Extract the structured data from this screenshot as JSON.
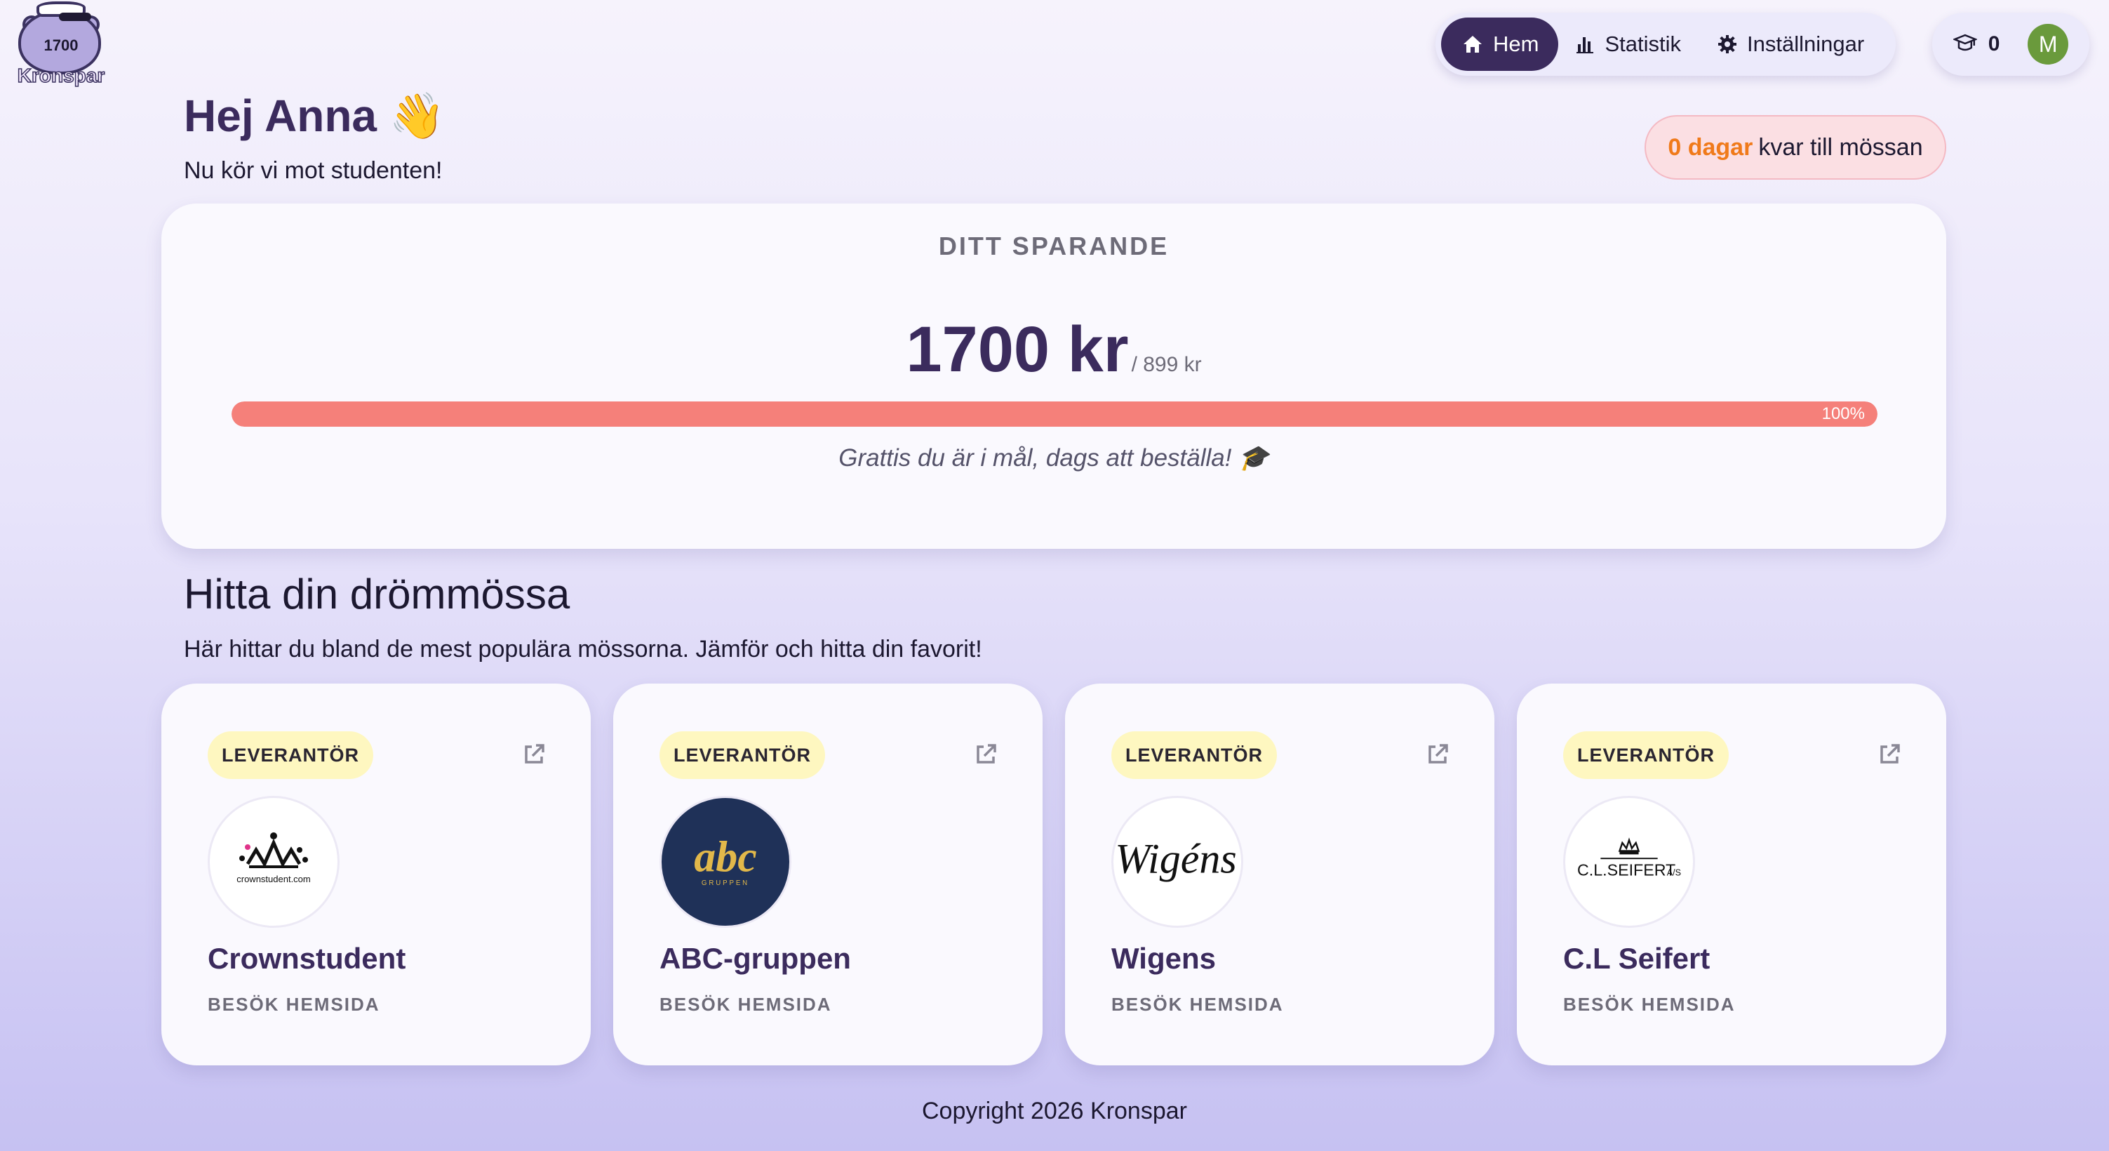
{
  "logo": {
    "amount": "1700",
    "brand": "Kronspar"
  },
  "nav": {
    "items": [
      {
        "label": "Hem",
        "icon": "home-icon",
        "active": true
      },
      {
        "label": "Statistik",
        "icon": "bar-chart-icon",
        "active": false
      },
      {
        "label": "Inställningar",
        "icon": "gear-icon",
        "active": false
      }
    ]
  },
  "user": {
    "cap_count": "0",
    "avatar_initial": "M",
    "avatar_color": "#6a9a3c"
  },
  "greeting": {
    "title": "Hej Anna 👋",
    "subtitle": "Nu kör vi mot studenten!"
  },
  "countdown": {
    "days": "0 dagar",
    "text": "kvar till mössan"
  },
  "savings": {
    "title": "DITT SPARANDE",
    "amount": "1700 kr",
    "goal": "/ 899 kr",
    "progress": 100,
    "progress_label": "100%",
    "message": "Grattis du är i mål, dags att beställa! 🎓"
  },
  "section": {
    "title": "Hitta din drömmössa",
    "subtitle": "Här hittar du bland de mest populära mössorna. Jämför och hitta din favorit!"
  },
  "vendors": [
    {
      "badge": "LEVERANTÖR",
      "name": "Crownstudent",
      "link": "BESÖK HEMSIDA",
      "logo_text": "crownstudent.com"
    },
    {
      "badge": "LEVERANTÖR",
      "name": "ABC-gruppen",
      "link": "BESÖK HEMSIDA",
      "logo_text": "abc",
      "logo_sub": "GRUPPEN"
    },
    {
      "badge": "LEVERANTÖR",
      "name": "Wigens",
      "link": "BESÖK HEMSIDA",
      "logo_text": "Wigéns"
    },
    {
      "badge": "LEVERANTÖR",
      "name": "C.L Seifert",
      "link": "BESÖK HEMSIDA",
      "logo_text": "C.L.SEIFERT",
      "logo_suffix": "A/S"
    }
  ],
  "footer": {
    "copyright": "Copyright 2026 Kronspar"
  },
  "colors": {
    "primary": "#3b2b5d",
    "progress": "#f5807a",
    "accent_orange": "#f07a1a",
    "badge_bg": "#fef7c0"
  }
}
